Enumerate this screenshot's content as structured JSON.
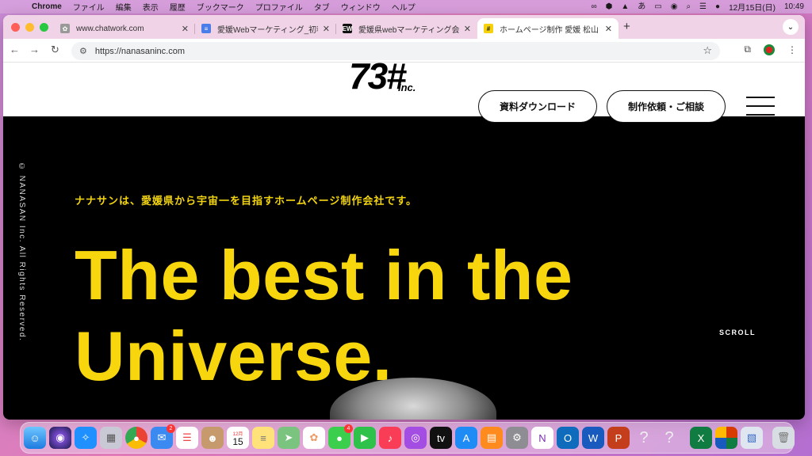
{
  "menubar": {
    "app_name": "Chrome",
    "items": [
      "ファイル",
      "編集",
      "表示",
      "履歴",
      "ブックマーク",
      "プロファイル",
      "タブ",
      "ウィンドウ",
      "ヘルプ"
    ],
    "clock_date": "12月15日(日)",
    "clock_time": "10:49",
    "input_mode": "あ"
  },
  "browser": {
    "tabs": [
      {
        "title": "www.chatwork.com",
        "favicon": "chatwork-icon",
        "active": false
      },
      {
        "title": "愛媛Webマーケティング_初稿 ◇",
        "favicon": "docs-icon",
        "active": false
      },
      {
        "title": "愛媛県webマーケティング会社お",
        "favicon": "EW",
        "active": false
      },
      {
        "title": "ホームページ制作 愛媛 松山｜We",
        "favicon": "#",
        "active": true
      }
    ],
    "url": "https://nanasaninc.com"
  },
  "site": {
    "logo_main": "73#",
    "logo_sub": "Inc.",
    "download_button": "資料ダウンロード",
    "contact_button": "制作依頼・ご相談",
    "copyright": "© NANASAN Inc. All Rights Reserved.",
    "tagline": "ナナサンは、愛媛県から宇宙一を目指すホームページ制作会社です。",
    "headline_line1": "The best in the",
    "headline_line2": "Universe.",
    "scroll_label": "SCROLL"
  },
  "dock": {
    "mail_badge": "2",
    "messages_badge": "4",
    "calendar_month": "12月",
    "calendar_day": "15",
    "apps": [
      "finder",
      "siri",
      "safari",
      "launchpad",
      "chrome",
      "mail",
      "reminders",
      "contacts",
      "calendar",
      "notes",
      "maps",
      "photos",
      "messages",
      "facetime",
      "music",
      "podcasts",
      "tv",
      "app-store",
      "books",
      "system-settings",
      "onenote",
      "outlook",
      "word",
      "powerpoint",
      "unknown",
      "unknown",
      "excel",
      "office",
      "preview",
      "trash"
    ]
  }
}
